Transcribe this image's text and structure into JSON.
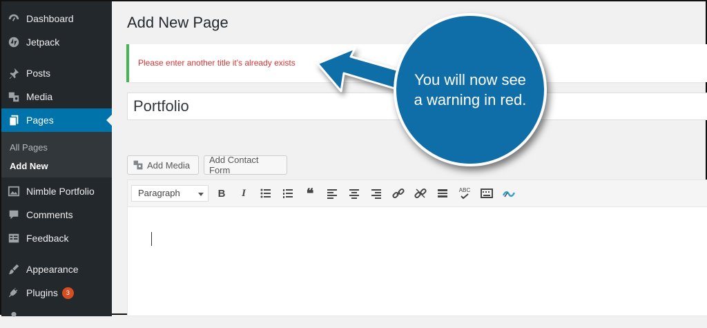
{
  "sidebar": {
    "items": [
      {
        "label": "Dashboard",
        "icon": "dashboard-icon"
      },
      {
        "label": "Jetpack",
        "icon": "jetpack-icon"
      },
      {
        "label": "Posts",
        "icon": "pin-icon"
      },
      {
        "label": "Media",
        "icon": "media-icon"
      },
      {
        "label": "Pages",
        "icon": "pages-icon",
        "active": true
      },
      {
        "label": "Nimble Portfolio",
        "icon": "portfolio-icon"
      },
      {
        "label": "Comments",
        "icon": "comment-icon"
      },
      {
        "label": "Feedback",
        "icon": "feedback-icon"
      },
      {
        "label": "Appearance",
        "icon": "brush-icon"
      },
      {
        "label": "Plugins",
        "icon": "plug-icon",
        "badge": "3"
      }
    ],
    "submenu": [
      {
        "label": "All Pages"
      },
      {
        "label": "Add New",
        "current": true
      }
    ]
  },
  "page": {
    "title": "Add New Page",
    "notice": "Please enter another title it's already exists",
    "title_value": "Portfolio"
  },
  "buttons": {
    "add_media": "Add Media",
    "add_contact_form": "Add Contact Form"
  },
  "toolbar": {
    "format": "Paragraph",
    "bold": "B",
    "italic": "I",
    "quote": "❝",
    "spellcheck": "ABC"
  },
  "callout": {
    "text": "You will now see a warning in red."
  },
  "colors": {
    "accent": "#0073aa",
    "sidebar": "#23282d",
    "notice_border": "#46b450",
    "notice_text": "#dc3232",
    "callout": "#0f6ea8"
  }
}
